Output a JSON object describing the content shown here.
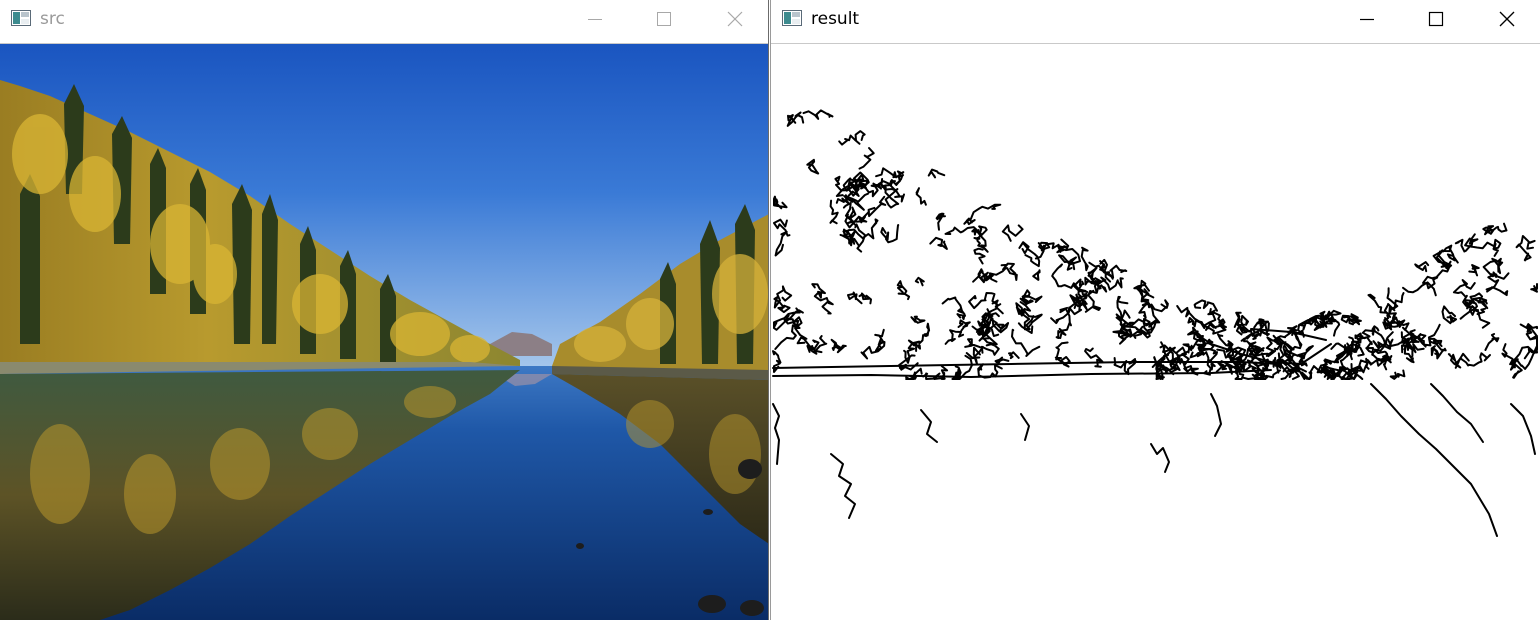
{
  "windows": {
    "src": {
      "title": "src",
      "title_color": "#9a9a9a",
      "icon": "app-window-icon",
      "controls": [
        "minimize-icon",
        "maximize-icon",
        "close-icon"
      ],
      "content": {
        "kind": "photo",
        "subject": "lake-with-autumn-forest-reflection",
        "colors": {
          "sky_top": "#1a5bc4",
          "sky_bottom": "#8cb7e4",
          "water": "#0e3676",
          "foliage": "#c9a32c",
          "conifer": "#2f3f1d"
        }
      }
    },
    "result": {
      "title": "result",
      "title_color": "#000000",
      "icon": "app-window-icon",
      "controls": [
        "minimize-icon",
        "maximize-icon",
        "close-icon"
      ],
      "content": {
        "kind": "edge-map",
        "colors": {
          "background": "#ffffff",
          "edges": "#000000"
        }
      }
    }
  }
}
